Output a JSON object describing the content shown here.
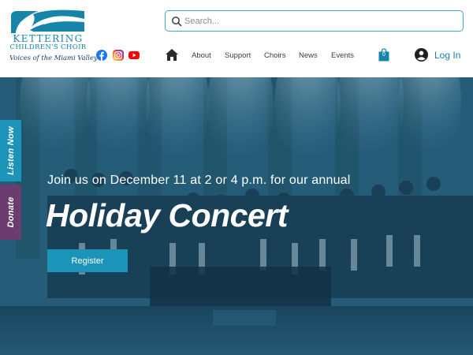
{
  "colors": {
    "brand_blue": "#1785a9",
    "tagline_navy": "#1b3f6b",
    "listen_tab": "#1c93b9",
    "donate_tab": "#6a3d6e",
    "register_button": "#1c93b9"
  },
  "logo": {
    "line1": "KETTERING",
    "line2": "CHILDREN'S CHOIR",
    "tagline": "Voices of the Miami Valley",
    "mark": "wave-logo-icon"
  },
  "search": {
    "placeholder": "Search...",
    "value": "",
    "icon": "search-icon"
  },
  "social": [
    {
      "name": "facebook-icon",
      "color": "#1877f2"
    },
    {
      "name": "instagram-icon",
      "color": "#d6249f"
    },
    {
      "name": "youtube-icon",
      "color": "#ff0000"
    }
  ],
  "nav": {
    "home_icon": "home-icon",
    "items": [
      "About",
      "Support",
      "Choirs",
      "News",
      "Events"
    ]
  },
  "cart": {
    "icon": "shopping-bag-icon",
    "count": "0"
  },
  "login": {
    "icon": "avatar-icon",
    "label": "Log In"
  },
  "side_tabs": {
    "listen": "Listen Now",
    "donate": "Donate"
  },
  "hero": {
    "subtitle": "Join us on December 11 at 2 or 4 p.m. for our annual",
    "title": "Holiday Concert",
    "cta": "Register"
  }
}
